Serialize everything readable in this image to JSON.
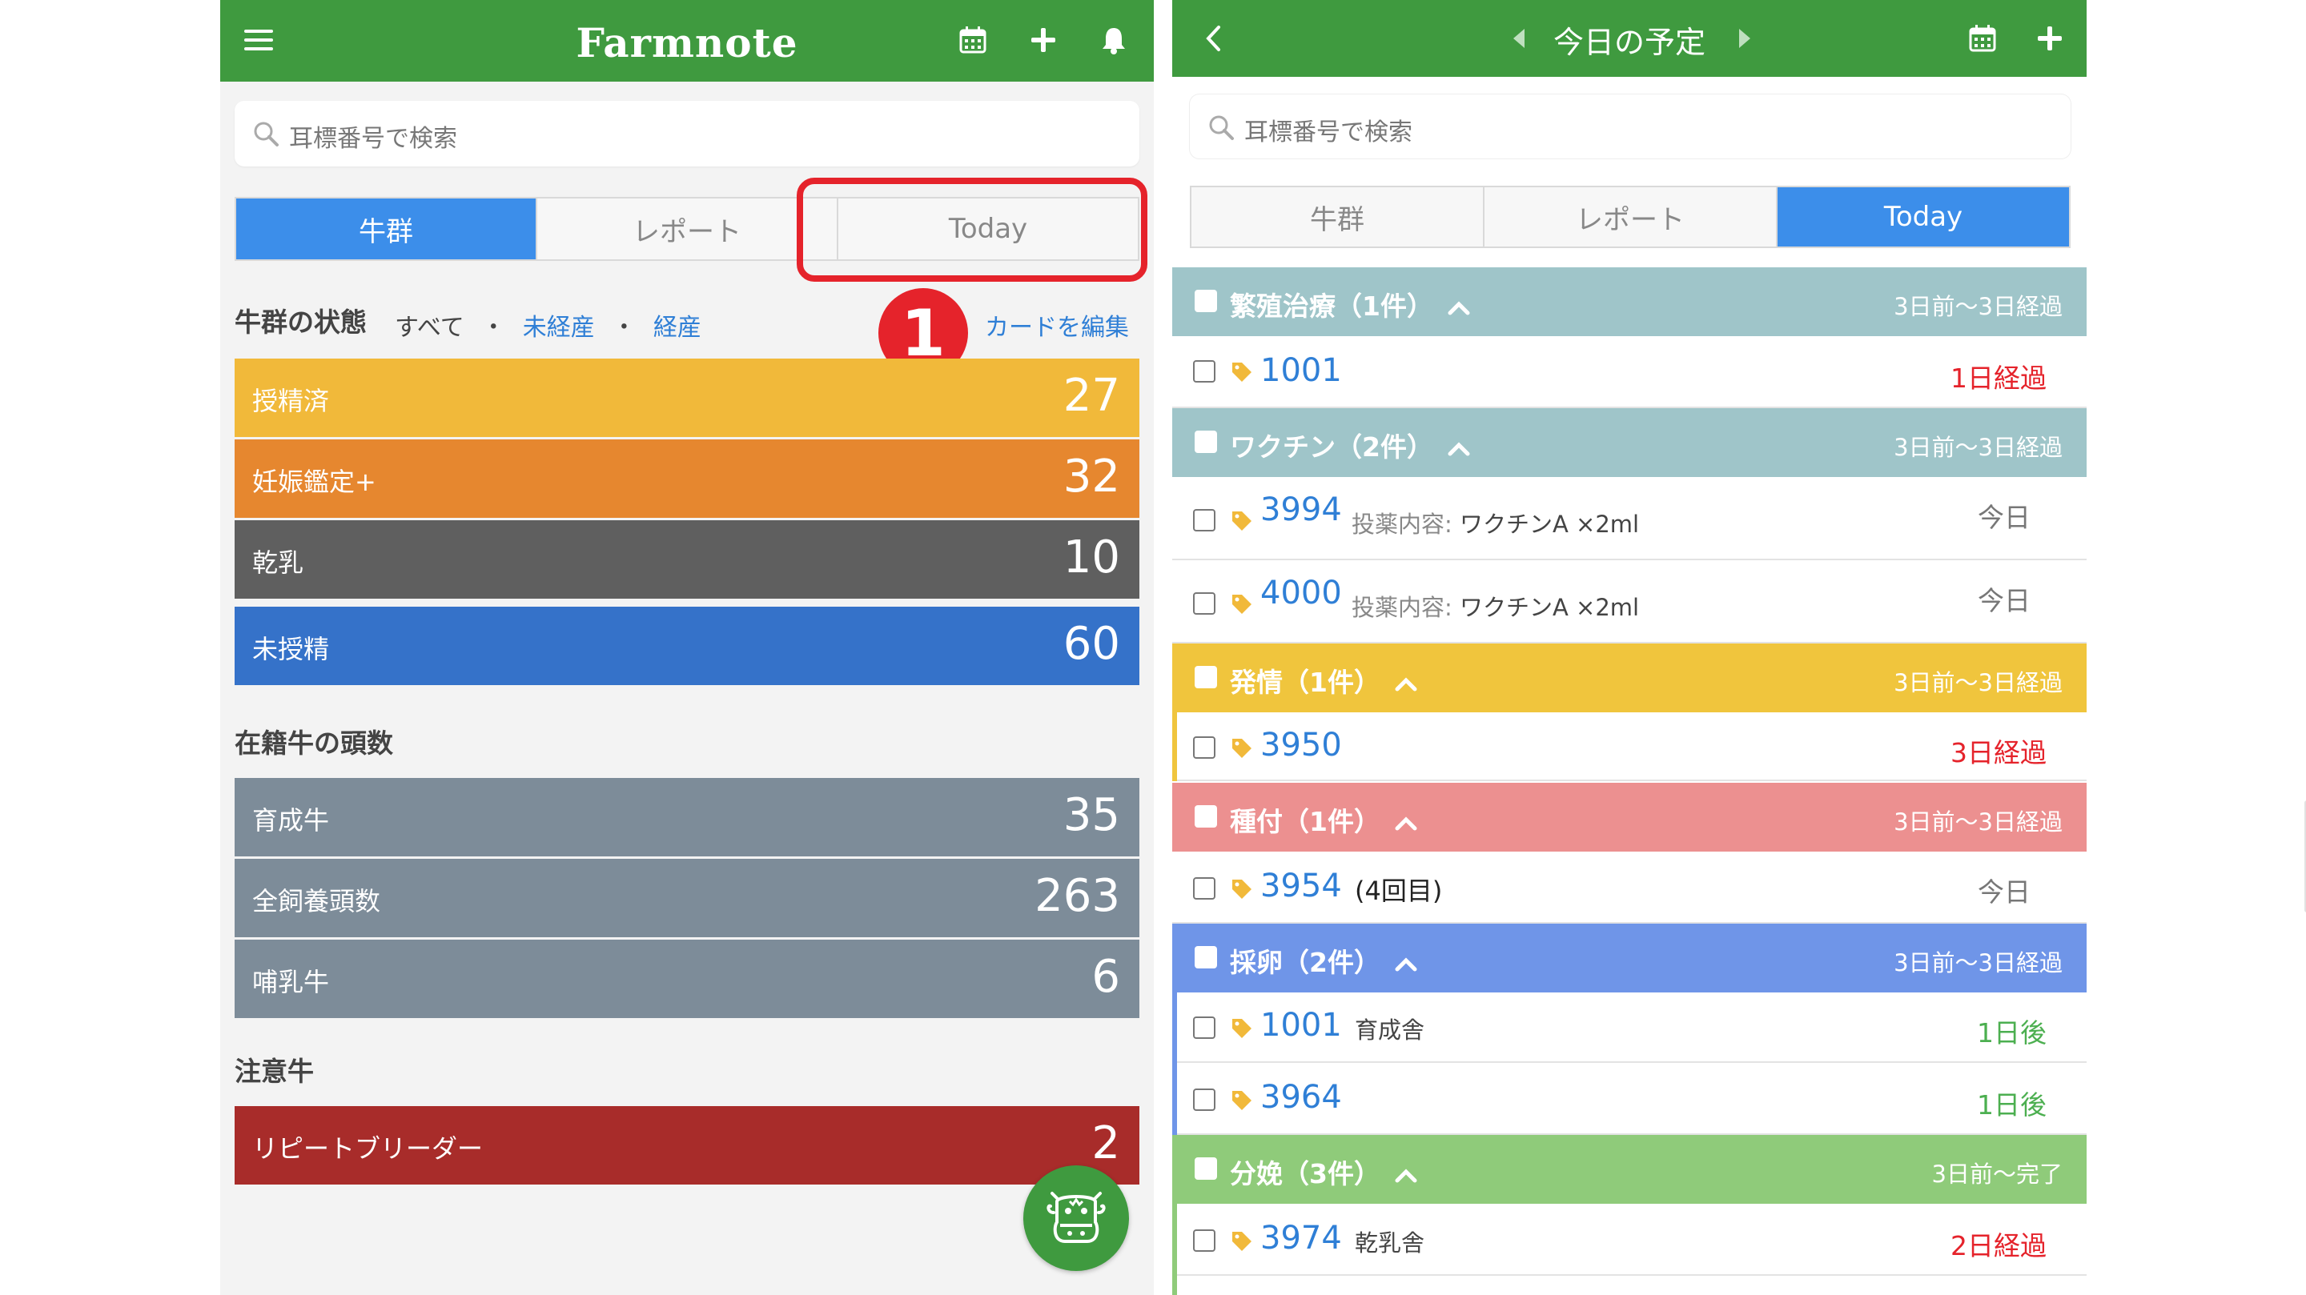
{
  "left": {
    "app_title": "Farmnote",
    "search": {
      "placeholder": "耳標番号で検索"
    },
    "tabs": [
      {
        "label": "牛群",
        "active": true
      },
      {
        "label": "レポート",
        "active": false
      },
      {
        "label": "Today",
        "active": false
      }
    ],
    "herd_status": {
      "title": "牛群の状態",
      "filter_all": "すべて",
      "filter_sep": "・",
      "filter_unparous": "未経産",
      "filter_parous": "経産",
      "edit_cards": "カードを編集",
      "cards": [
        {
          "label": "授精済",
          "value": "27",
          "color": "#f1b93a"
        },
        {
          "label": "妊娠鑑定+",
          "value": "32",
          "color": "#e6872f"
        },
        {
          "label": "乾乳",
          "value": "10",
          "color": "#5f5f5f"
        },
        {
          "label": "未授精",
          "value": "60",
          "color": "#3572c9"
        }
      ]
    },
    "headcount": {
      "title": "在籍牛の頭数",
      "cards": [
        {
          "label": "育成牛",
          "value": "35",
          "color": "#7d8c99"
        },
        {
          "label": "全飼養頭数",
          "value": "263",
          "color": "#7d8c99"
        },
        {
          "label": "哺乳牛",
          "value": "6",
          "color": "#7d8c99"
        }
      ]
    },
    "attention": {
      "title": "注意牛",
      "cards": [
        {
          "label": "リピートブリーダー",
          "value": "2",
          "color": "#a82c2a"
        }
      ]
    },
    "annotation_number": "1"
  },
  "right": {
    "title": "今日の予定",
    "search": {
      "placeholder": "耳標番号で検索"
    },
    "tabs": [
      {
        "label": "牛群",
        "active": false
      },
      {
        "label": "レポート",
        "active": false
      },
      {
        "label": "Today",
        "active": true
      }
    ],
    "groups": [
      {
        "title": "繁殖治療（1件）",
        "range": "3日前〜3日経過",
        "color": "#9fc5c9",
        "items": [
          {
            "id": "1001",
            "detail_key": "",
            "detail": "",
            "status": "1日経過",
            "status_color": "#e5232b"
          }
        ]
      },
      {
        "title": "ワクチン（2件）",
        "range": "3日前〜3日経過",
        "color": "#9fc5c9",
        "items": [
          {
            "id": "3994",
            "detail_key": "投薬内容:",
            "detail": "ワクチンA ×2ml",
            "status": "今日",
            "status_color": "#777777"
          },
          {
            "id": "4000",
            "detail_key": "投薬内容:",
            "detail": "ワクチンA ×2ml",
            "status": "今日",
            "status_color": "#777777"
          }
        ]
      },
      {
        "title": "発情（1件）",
        "range": "3日前〜3日経過",
        "color": "#f0c53d",
        "items": [
          {
            "id": "3950",
            "detail_key": "",
            "detail": "",
            "status": "3日経過",
            "status_color": "#e5232b"
          }
        ]
      },
      {
        "title": "種付（1件）",
        "range": "3日前〜3日経過",
        "color": "#ec9090",
        "items": [
          {
            "id": "3954",
            "detail_key": "",
            "detail": "(4回目)",
            "status": "今日",
            "status_color": "#777777"
          }
        ]
      },
      {
        "title": "採卵（2件）",
        "range": "3日前〜3日経過",
        "color": "#6f95e8",
        "items": [
          {
            "id": "1001",
            "detail_key": "",
            "detail": "育成舎",
            "status": "1日後",
            "status_color": "#4caf50"
          },
          {
            "id": "3964",
            "detail_key": "",
            "detail": "",
            "status": "1日後",
            "status_color": "#4caf50"
          }
        ]
      },
      {
        "title": "分娩（3件）",
        "range": "3日前〜完了",
        "color": "#8fcb7a",
        "items": [
          {
            "id": "3974",
            "detail_key": "",
            "detail": "乾乳舎",
            "status": "2日経過",
            "status_color": "#e5232b"
          }
        ]
      }
    ]
  }
}
